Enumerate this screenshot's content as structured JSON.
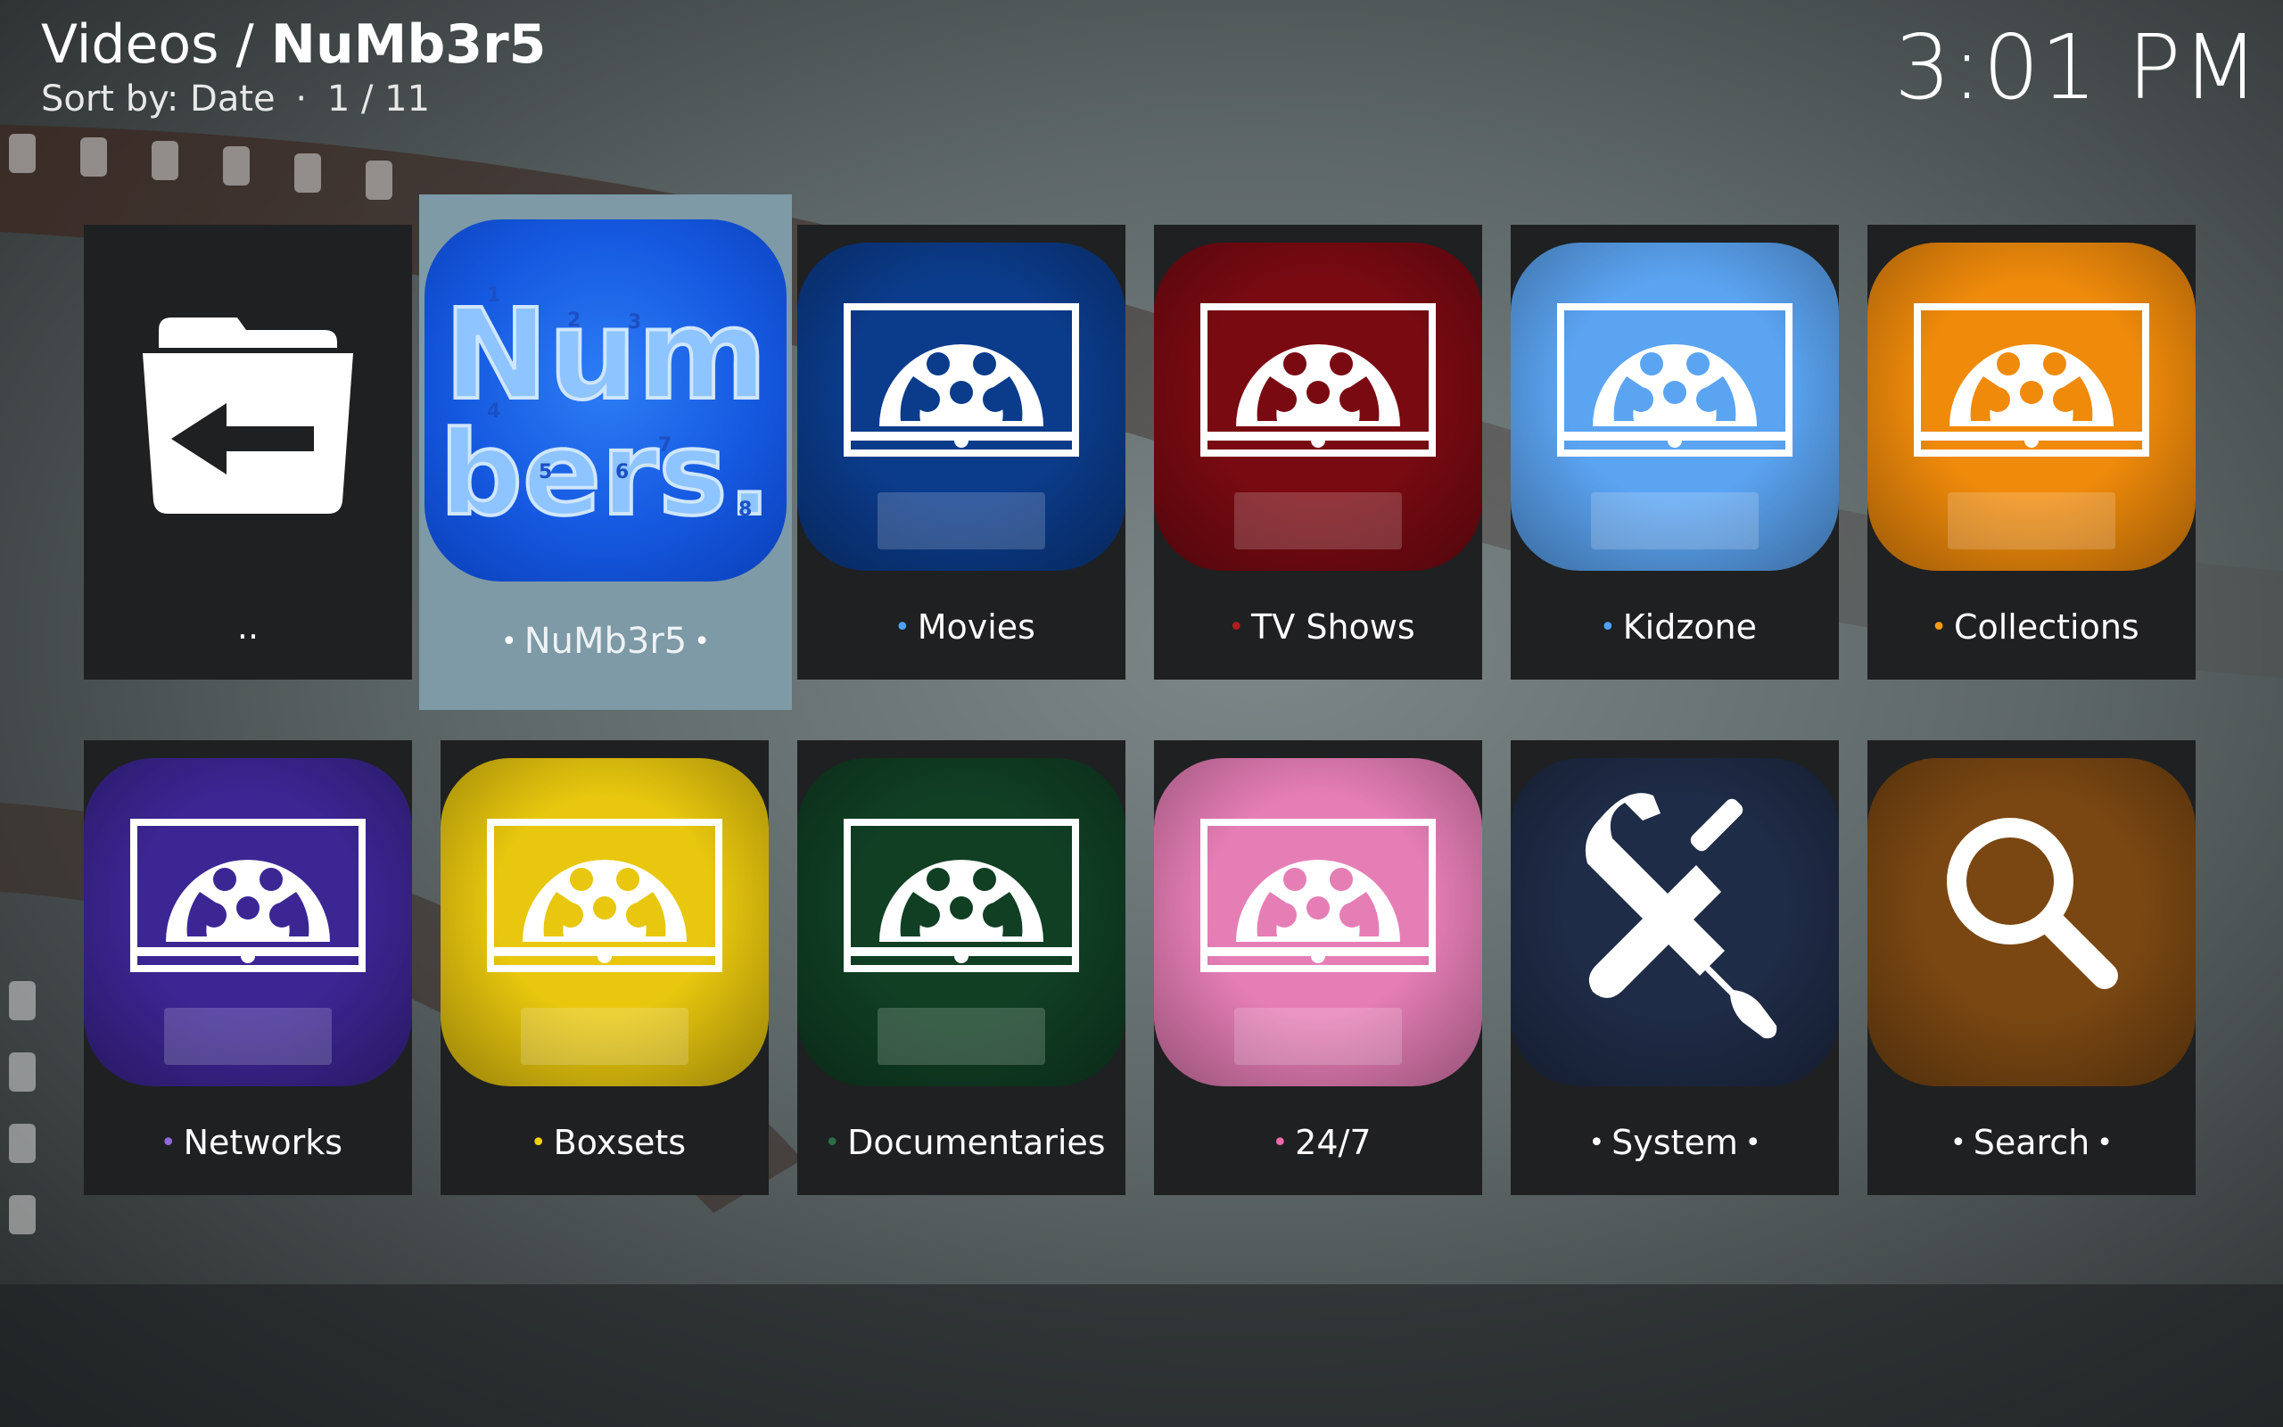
{
  "header": {
    "breadcrumb_root": "Videos",
    "breadcrumb_sep": " / ",
    "breadcrumb_current": "NuMb3r5",
    "sort_label": "Sort by: Date",
    "separator": "·",
    "position": "1 / 11"
  },
  "clock": "3:01 PM",
  "tiles": [
    {
      "label": "..",
      "dot_color": "",
      "icon": "back-folder-icon"
    },
    {
      "label": "NuMb3r5",
      "dot_color": "#ffffff",
      "icon": "numbers-logo",
      "focused": true
    },
    {
      "label": "Movies",
      "dot_color": "#4ea0ff",
      "art_color": "#0b3c8c",
      "icon": "film-reel-icon"
    },
    {
      "label": "TV Shows",
      "dot_color": "#b01d1d",
      "art_color": "#7a0a12",
      "icon": "film-reel-icon"
    },
    {
      "label": "Kidzone",
      "dot_color": "#4ea0ff",
      "art_color": "#5ba4f2",
      "icon": "film-reel-icon"
    },
    {
      "label": "Collections",
      "dot_color": "#ff9a1a",
      "art_color": "#ef8a0b",
      "icon": "film-reel-icon"
    },
    {
      "label": "Networks",
      "dot_color": "#8f6ad8",
      "art_color": "#3c2694",
      "icon": "film-reel-icon"
    },
    {
      "label": "Boxsets",
      "dot_color": "#f2cf12",
      "art_color": "#e8c70e",
      "icon": "film-reel-icon"
    },
    {
      "label": "Documentaries",
      "dot_color": "#2e6d45",
      "art_color": "#103f24",
      "icon": "film-reel-icon"
    },
    {
      "label": "24/7",
      "dot_color": "#ec6aa7",
      "art_color": "#e67eb6",
      "icon": "film-reel-icon"
    },
    {
      "label": "System",
      "dot_color": "#ffffff",
      "art_color": "#1f2c47",
      "icon": "wrench-screwdriver-icon"
    },
    {
      "label": "Search",
      "dot_color": "#ffffff",
      "art_color": "#7a4712",
      "icon": "magnifier-icon"
    }
  ],
  "numbers_logo": {
    "line1": "Num",
    "line2": "bers.",
    "digits": [
      "1",
      "2",
      "3",
      "4",
      "5",
      "6",
      "7",
      "8"
    ]
  }
}
